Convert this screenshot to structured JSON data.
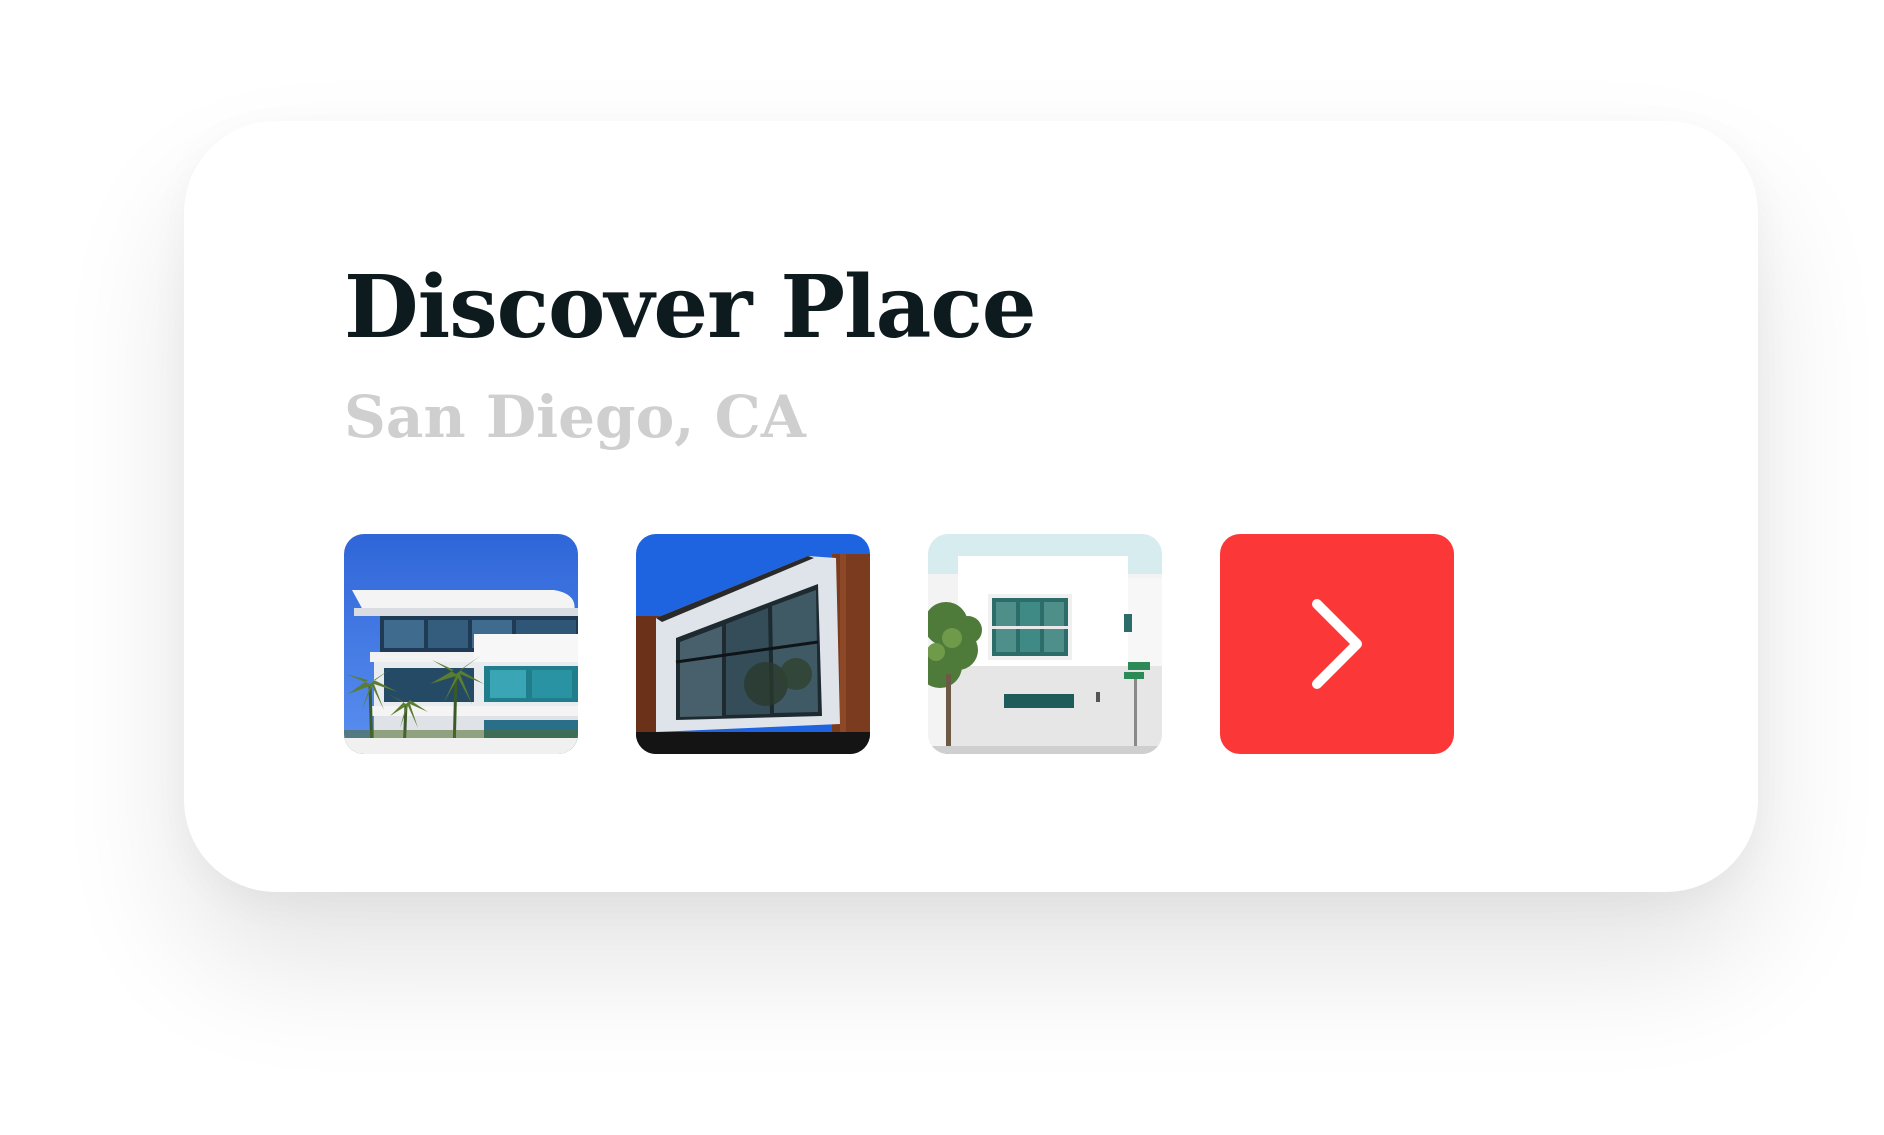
{
  "card": {
    "title": "Discover Place",
    "location": "San Diego, CA"
  },
  "gallery": {
    "thumbnails": [
      {
        "icon": "modern-house-photo-1"
      },
      {
        "icon": "modern-house-photo-2"
      },
      {
        "icon": "modern-house-photo-3"
      }
    ],
    "next_button": {
      "icon": "chevron-right-icon",
      "color": "#fb3737"
    }
  },
  "colors": {
    "title": "#0d1a1e",
    "subtitle": "#cfcfcf",
    "accent": "#fb3737",
    "background": "#ffffff"
  }
}
